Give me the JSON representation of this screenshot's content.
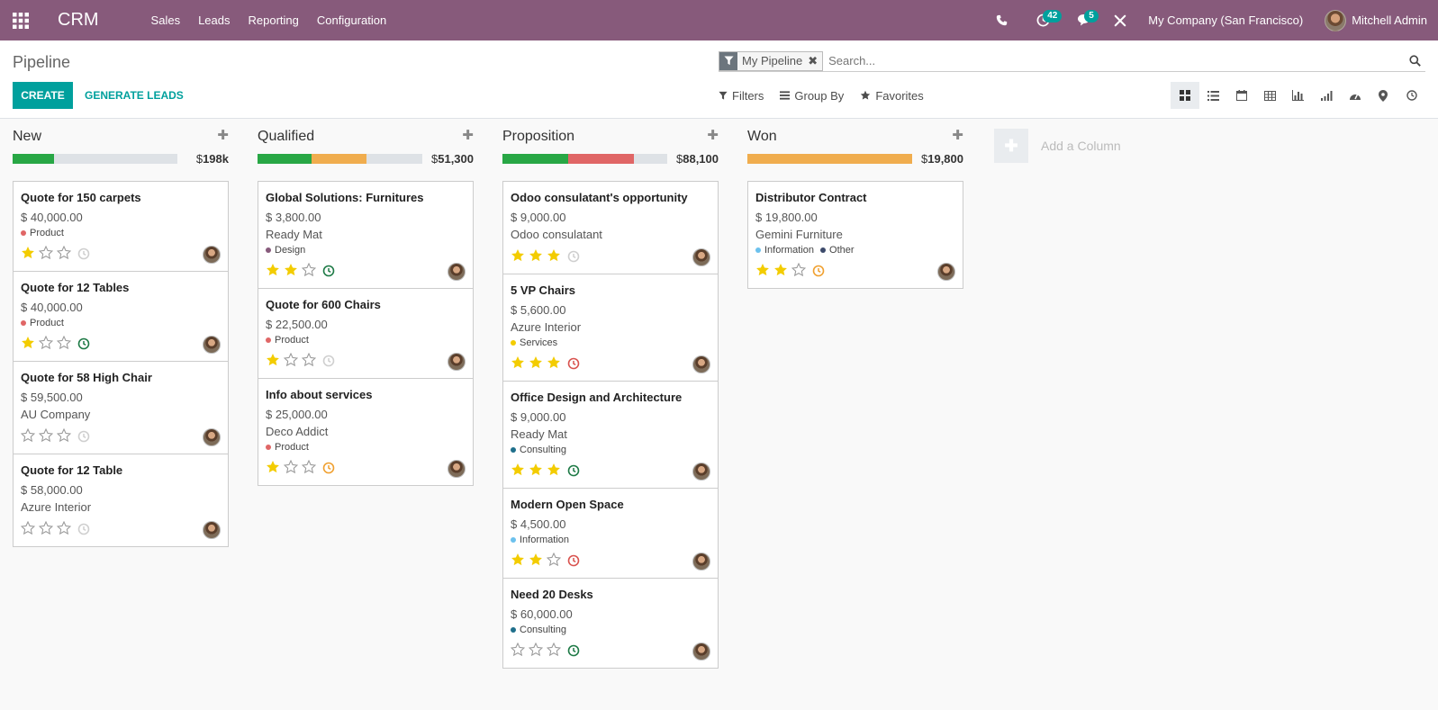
{
  "navbar": {
    "brand": "CRM",
    "menu": [
      "Sales",
      "Leads",
      "Reporting",
      "Configuration"
    ],
    "activities_count": "42",
    "messages_count": "5",
    "company": "My Company (San Francisco)",
    "user": "Mitchell Admin"
  },
  "control_panel": {
    "breadcrumb": "Pipeline",
    "facet": "My Pipeline",
    "search_placeholder": "Search...",
    "create_label": "CREATE",
    "generate_label": "GENERATE LEADS",
    "filters_label": "Filters",
    "groupby_label": "Group By",
    "favorites_label": "Favorites",
    "views": [
      "kanban-icon",
      "list-icon",
      "calendar-icon",
      "pivot-icon",
      "graph-icon",
      "cohort-icon",
      "dashboard-icon",
      "map-icon",
      "activity-icon"
    ]
  },
  "colors": {
    "brand": "#875a7b",
    "accent": "#00a09d",
    "green": "#28a745",
    "orange": "#f0ad4e",
    "red": "#e06666",
    "star": "#f3cc00"
  },
  "columns": [
    {
      "title": "New",
      "currency": "$",
      "total": "198k",
      "progress": [
        {
          "color": "green",
          "fraction": 0.25
        }
      ],
      "cards": [
        {
          "title": "Quote for 150 carpets",
          "amount": "$ 40,000.00",
          "company": "",
          "tags": [
            {
              "label": "Product",
              "color": "#e06666"
            }
          ],
          "stars": 1,
          "activity": "none"
        },
        {
          "title": "Quote for 12 Tables",
          "amount": "$ 40,000.00",
          "company": "",
          "tags": [
            {
              "label": "Product",
              "color": "#e06666"
            }
          ],
          "stars": 1,
          "activity": "planned"
        },
        {
          "title": "Quote for 58 High Chair",
          "amount": "$ 59,500.00",
          "company": "AU Company",
          "tags": [],
          "stars": 0,
          "activity": "none"
        },
        {
          "title": "Quote for 12 Table",
          "amount": "$ 58,000.00",
          "company": "Azure Interior",
          "tags": [],
          "stars": 0,
          "activity": "none"
        }
      ]
    },
    {
      "title": "Qualified",
      "currency": "$",
      "total": "51,300",
      "progress": [
        {
          "color": "green",
          "fraction": 0.33
        },
        {
          "color": "orange",
          "fraction": 0.33
        }
      ],
      "cards": [
        {
          "title": "Global Solutions: Furnitures",
          "amount": "$ 3,800.00",
          "company": "Ready Mat",
          "tags": [
            {
              "label": "Design",
              "color": "#875a7b"
            }
          ],
          "stars": 2,
          "activity": "planned"
        },
        {
          "title": "Quote for 600 Chairs",
          "amount": "$ 22,500.00",
          "company": "",
          "tags": [
            {
              "label": "Product",
              "color": "#e06666"
            }
          ],
          "stars": 1,
          "activity": "none"
        },
        {
          "title": "Info about services",
          "amount": "$ 25,000.00",
          "company": "Deco Addict",
          "tags": [
            {
              "label": "Product",
              "color": "#e06666"
            }
          ],
          "stars": 1,
          "activity": "today"
        }
      ]
    },
    {
      "title": "Proposition",
      "currency": "$",
      "total": "88,100",
      "progress": [
        {
          "color": "green",
          "fraction": 0.4
        },
        {
          "color": "red",
          "fraction": 0.4
        }
      ],
      "cards": [
        {
          "title": "Odoo consulatant's opportunity",
          "amount": "$ 9,000.00",
          "company": "Odoo consulatant",
          "tags": [],
          "stars": 3,
          "activity": "none"
        },
        {
          "title": "5 VP Chairs",
          "amount": "$ 5,600.00",
          "company": "Azure Interior",
          "tags": [
            {
              "label": "Services",
              "color": "#f3cc00"
            }
          ],
          "stars": 3,
          "activity": "overdue"
        },
        {
          "title": "Office Design and Architecture",
          "amount": "$ 9,000.00",
          "company": "Ready Mat",
          "tags": [
            {
              "label": "Consulting",
              "color": "#1f6f8b"
            }
          ],
          "stars": 3,
          "activity": "planned"
        },
        {
          "title": "Modern Open Space",
          "amount": "$ 4,500.00",
          "company": "",
          "tags": [
            {
              "label": "Information",
              "color": "#6cc1ed"
            }
          ],
          "stars": 2,
          "activity": "overdue"
        },
        {
          "title": "Need 20 Desks",
          "amount": "$ 60,000.00",
          "company": "",
          "tags": [
            {
              "label": "Consulting",
              "color": "#1f6f8b"
            }
          ],
          "stars": 0,
          "activity": "planned"
        }
      ]
    },
    {
      "title": "Won",
      "currency": "$",
      "total": "19,800",
      "progress": [
        {
          "color": "orange",
          "fraction": 1.0
        }
      ],
      "cards": [
        {
          "title": "Distributor Contract",
          "amount": "$ 19,800.00",
          "company": "Gemini Furniture",
          "tags": [
            {
              "label": "Information",
              "color": "#6cc1ed"
            },
            {
              "label": "Other",
              "color": "#3c4a6b"
            }
          ],
          "stars": 2,
          "activity": "today"
        }
      ]
    }
  ],
  "add_column_label": "Add a Column"
}
